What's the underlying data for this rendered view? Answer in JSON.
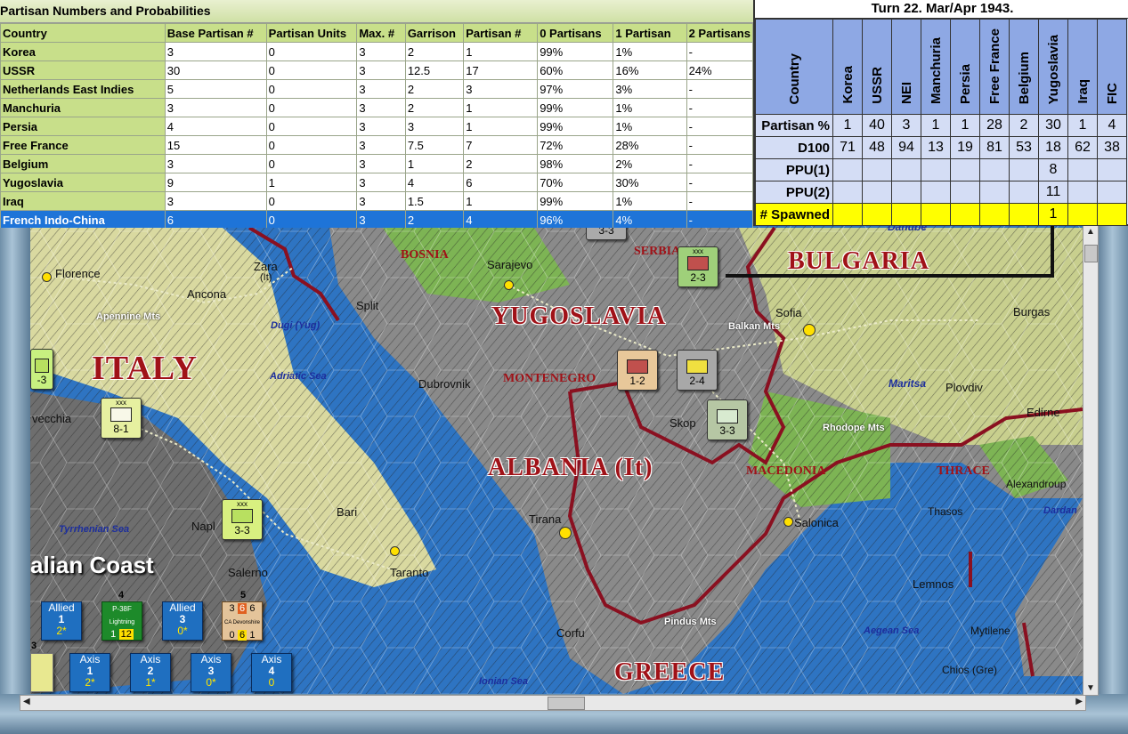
{
  "partisan_table": {
    "title": "Partisan Numbers and Probabilities",
    "columns": [
      "Country",
      "Base Partisan #",
      "Partisan Units",
      "Max. #",
      "Garrison",
      "Partisan #",
      "0 Partisans",
      "1 Partisan",
      "2 Partisans"
    ],
    "rows": [
      [
        "Korea",
        "3",
        "0",
        "3",
        "2",
        "1",
        "99%",
        "1%",
        "-"
      ],
      [
        "USSR",
        "30",
        "0",
        "3",
        "12.5",
        "17",
        "60%",
        "16%",
        "24%"
      ],
      [
        "Netherlands East Indies",
        "5",
        "0",
        "3",
        "2",
        "3",
        "97%",
        "3%",
        "-"
      ],
      [
        "Manchuria",
        "3",
        "0",
        "3",
        "2",
        "1",
        "99%",
        "1%",
        "-"
      ],
      [
        "Persia",
        "4",
        "0",
        "3",
        "3",
        "1",
        "99%",
        "1%",
        "-"
      ],
      [
        "Free France",
        "15",
        "0",
        "3",
        "7.5",
        "7",
        "72%",
        "28%",
        "-"
      ],
      [
        "Belgium",
        "3",
        "0",
        "3",
        "1",
        "2",
        "98%",
        "2%",
        "-"
      ],
      [
        "Yugoslavia",
        "9",
        "1",
        "3",
        "4",
        "6",
        "70%",
        "30%",
        "-"
      ],
      [
        "Iraq",
        "3",
        "0",
        "3",
        "1.5",
        "1",
        "99%",
        "1%",
        "-"
      ],
      [
        "French Indo-China",
        "6",
        "0",
        "3",
        "2",
        "4",
        "96%",
        "4%",
        "-"
      ]
    ],
    "selected_row": "French Indo-China"
  },
  "turn_panel": {
    "title": "Turn 22.  Mar/Apr 1943.",
    "corner_label": "Country",
    "countries": [
      "Korea",
      "USSR",
      "NEI",
      "Manchuria",
      "Persia",
      "Free France",
      "Belgium",
      "Yugoslavia",
      "Iraq",
      "FIC"
    ],
    "rows": [
      {
        "label": "Partisan %",
        "values": [
          "1",
          "40",
          "3",
          "1",
          "1",
          "28",
          "2",
          "30",
          "1",
          "4"
        ]
      },
      {
        "label": "D100",
        "values": [
          "71",
          "48",
          "94",
          "13",
          "19",
          "81",
          "53",
          "18",
          "62",
          "38"
        ]
      },
      {
        "label": "PPU(1)",
        "values": [
          "",
          "",
          "",
          "",
          "",
          "",
          "",
          "8",
          "",
          ""
        ]
      },
      {
        "label": "PPU(2)",
        "values": [
          "",
          "",
          "",
          "",
          "",
          "",
          "",
          "11",
          "",
          ""
        ]
      },
      {
        "label": "# Spawned",
        "values": [
          "",
          "",
          "",
          "",
          "",
          "",
          "",
          "1",
          "",
          ""
        ]
      }
    ]
  },
  "map": {
    "countries": [
      "ITALY",
      "YUGOSLAVIA",
      "ALBANIA (It)",
      "BULGARIA",
      "GREECE"
    ],
    "regions": [
      "BOSNIA",
      "SERBIA",
      "MONTENEGRO",
      "MACEDONIA",
      "THRACE"
    ],
    "cities": [
      "Florence",
      "Ancona",
      "Zara",
      "(It)",
      "Split",
      "Sarajevo",
      "Sofia",
      "Burgas",
      "Plovdiv",
      "Edirne",
      "Dubrovnik",
      "Skop",
      "Tirana",
      "Salonica",
      "Bari",
      "Napl",
      "Salerno",
      "Taranto",
      "Corfu",
      "Lemnos",
      "Thasos",
      "Mytilene",
      "Chios (Gre)",
      "Alexandroup",
      "vecchia"
    ],
    "seas": [
      "Adriatic Sea",
      "Tyrrhenian Sea",
      "Ionian Sea",
      "Aegean Sea",
      "Dugi (Yug)",
      "Maritsa",
      "Dardan"
    ],
    "mountains": [
      "Apennine Mts",
      "Balkan Mts",
      "Rhodope Mts",
      "Pindus Mts"
    ],
    "coast_label": "alian Coast",
    "partial_label": "Danube",
    "units": [
      {
        "id": "serbia",
        "size": "xxx",
        "strength": "2-3",
        "color": "#9fd07a"
      },
      {
        "id": "montenegro1",
        "size": "",
        "strength": "1-2",
        "color": "#e8c89a"
      },
      {
        "id": "montenegro2",
        "size": "",
        "strength": "2-4",
        "color": "#a8a8a8"
      },
      {
        "id": "skopje",
        "size": "",
        "strength": "3-3",
        "color": "#b6c7a4"
      },
      {
        "id": "italy-west",
        "size": "xxx",
        "strength": "8-1",
        "color": "#e6f0a0"
      },
      {
        "id": "naples",
        "size": "xxx",
        "strength": "3-3",
        "color": "#d8f080"
      },
      {
        "id": "top",
        "size": "",
        "strength": "3-3",
        "color": "#aaa"
      },
      {
        "id": "left-edge",
        "size": "",
        "strength": "-3",
        "color": "#c8f080"
      }
    ],
    "boxes": {
      "allied": [
        {
          "label": "Allied",
          "num": "1",
          "sub": "2*"
        },
        {
          "label": "Allied",
          "num": "3",
          "sub": "0*"
        }
      ],
      "axis": [
        {
          "label": "Axis",
          "num": "1",
          "sub": "2*"
        },
        {
          "label": "Axis",
          "num": "2",
          "sub": "1*"
        },
        {
          "label": "Axis",
          "num": "3",
          "sub": "0*"
        },
        {
          "label": "Axis",
          "num": "4",
          "sub": "0"
        }
      ],
      "air_unit": {
        "count": "4",
        "name": "P-38F",
        "sub": "Lightning",
        "left": "1",
        "right": "12"
      },
      "naval_unit": {
        "count": "5",
        "name": "CA Devonshire",
        "tl": "3",
        "tm": "6",
        "tr": "6",
        "bl": "0",
        "bm": "6",
        "br": "1"
      },
      "left_count": "3"
    }
  }
}
